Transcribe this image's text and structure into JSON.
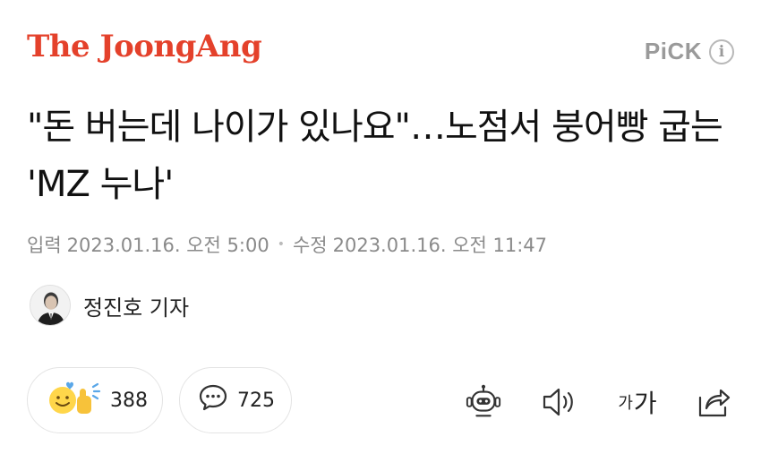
{
  "header": {
    "logo_text": "The JoongAng",
    "logo_color": "#e4412b",
    "pick_label": "PiCK",
    "info_icon_glyph": "i"
  },
  "article": {
    "headline": "\"돈 버는데 나이가 있나요\"…노점서 붕어빵 굽는 'MZ 누나'",
    "published_label": "입력",
    "published_time": "2023.01.16. 오전 5:00",
    "modified_label": "수정",
    "modified_time": "2023.01.16. 오전 11:47",
    "reporter": "정진호 기자"
  },
  "actions": {
    "reaction_count": "388",
    "comment_count": "725",
    "fontsize_small": "가",
    "fontsize_large": "가"
  },
  "icons": [
    "info-icon",
    "reaction-emoji-icon",
    "comment-bubble-icon",
    "tts-robot-icon",
    "speaker-icon",
    "font-size-icon",
    "share-icon"
  ]
}
